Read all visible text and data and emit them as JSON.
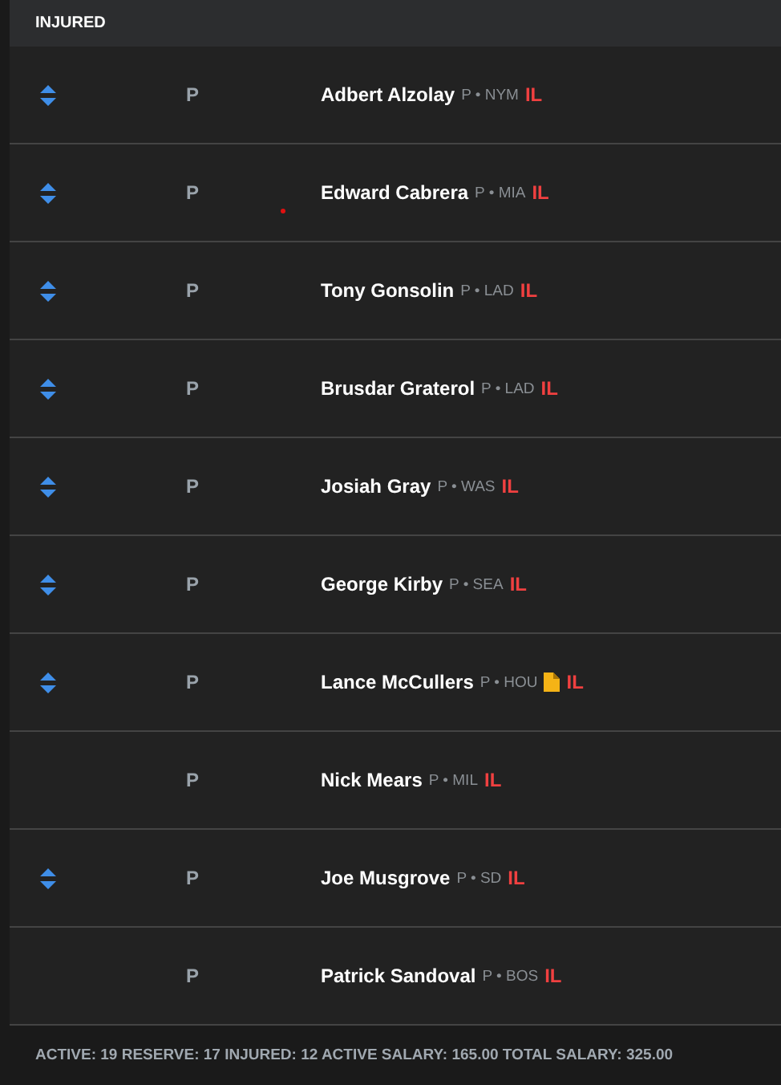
{
  "section": {
    "title": "INJURED"
  },
  "players": [
    {
      "movable": true,
      "position": "P",
      "name": "Adbert Alzolay",
      "meta": "P • NYM",
      "note": false,
      "status": "IL",
      "dot": false
    },
    {
      "movable": true,
      "position": "P",
      "name": "Edward Cabrera",
      "meta": "P • MIA",
      "note": false,
      "status": "IL",
      "dot": true
    },
    {
      "movable": true,
      "position": "P",
      "name": "Tony Gonsolin",
      "meta": "P • LAD",
      "note": false,
      "status": "IL",
      "dot": false
    },
    {
      "movable": true,
      "position": "P",
      "name": "Brusdar Graterol",
      "meta": "P • LAD",
      "note": false,
      "status": "IL",
      "dot": false
    },
    {
      "movable": true,
      "position": "P",
      "name": "Josiah Gray",
      "meta": "P • WAS",
      "note": false,
      "status": "IL",
      "dot": false
    },
    {
      "movable": true,
      "position": "P",
      "name": "George Kirby",
      "meta": "P • SEA",
      "note": false,
      "status": "IL",
      "dot": false
    },
    {
      "movable": true,
      "position": "P",
      "name": "Lance McCullers",
      "meta": "P • HOU",
      "note": true,
      "status": "IL",
      "dot": false
    },
    {
      "movable": false,
      "position": "P",
      "name": "Nick Mears",
      "meta": "P • MIL",
      "note": false,
      "status": "IL",
      "dot": false
    },
    {
      "movable": true,
      "position": "P",
      "name": "Joe Musgrove",
      "meta": "P • SD",
      "note": false,
      "status": "IL",
      "dot": false
    },
    {
      "movable": false,
      "position": "P",
      "name": "Patrick Sandoval",
      "meta": "P • BOS",
      "note": false,
      "status": "IL",
      "dot": false
    }
  ],
  "footer": "ACTIVE: 19 RESERVE: 17 INJURED: 12 ACTIVE SALARY: 165.00 TOTAL SALARY: 325.00"
}
